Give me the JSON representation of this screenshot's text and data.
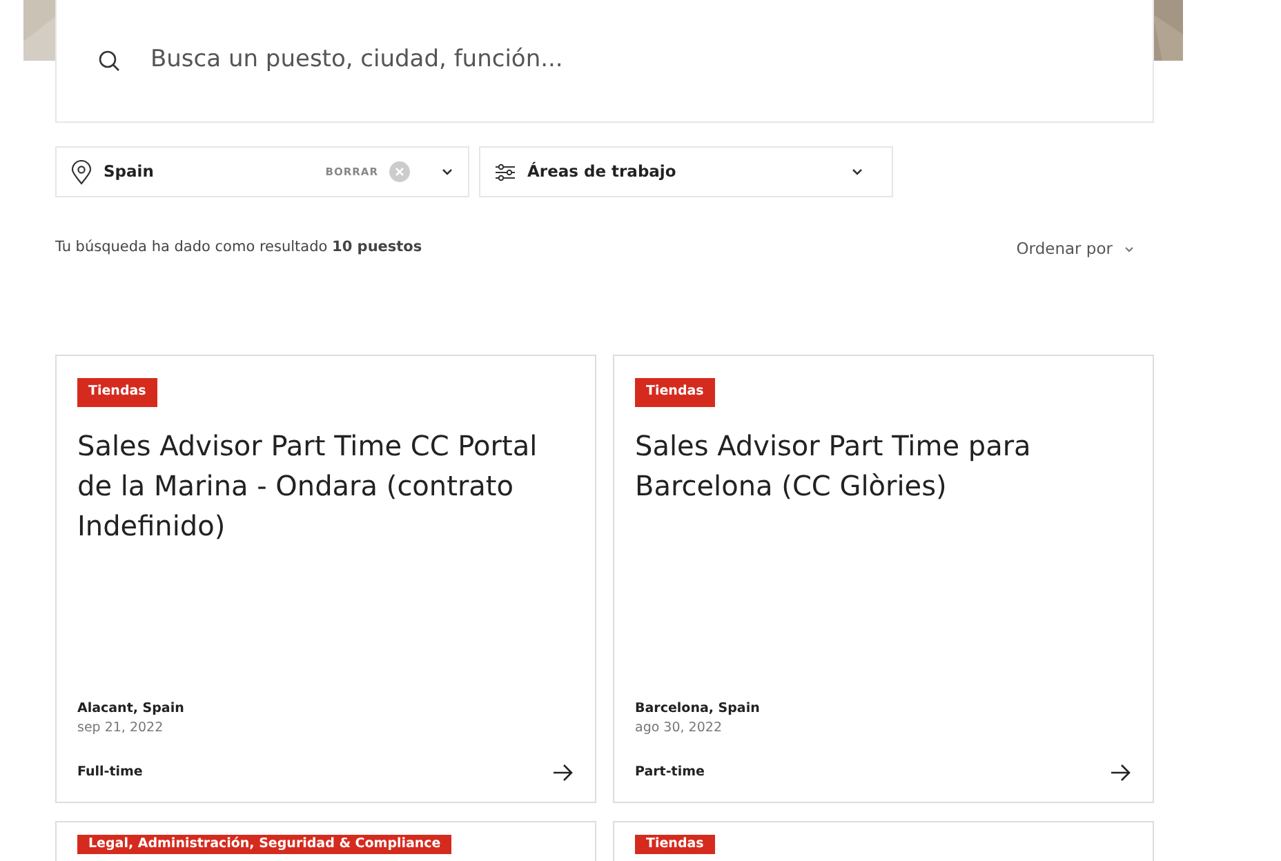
{
  "search": {
    "placeholder": "Busca un puesto, ciudad, función..."
  },
  "filters": [
    {
      "kind": "location",
      "value": "Spain",
      "clear_label": "BORRAR"
    },
    {
      "kind": "areas",
      "value": "Áreas de trabajo"
    }
  ],
  "results_text": "Tu búsqueda ha dado como resultado **10 puestos**",
  "sort_label": "Ordenar por",
  "jobs": [
    {
      "tag": "Tiendas",
      "title": "Sales Advisor Part Time CC Portal de la Marina - Ondara (contrato Indefinido)",
      "location": "Alacant, Spain",
      "date": "sep 21, 2022",
      "type": "Full-time"
    },
    {
      "tag": "Tiendas",
      "title": "Sales Advisor Part Time para Barcelona (CC Glòries)",
      "location": "Barcelona, Spain",
      "date": "ago 30, 2022",
      "type": "Part-time"
    },
    {
      "tag": "Legal, Administración, Seguridad & Compliance"
    },
    {
      "tag": "Tiendas"
    }
  ]
}
